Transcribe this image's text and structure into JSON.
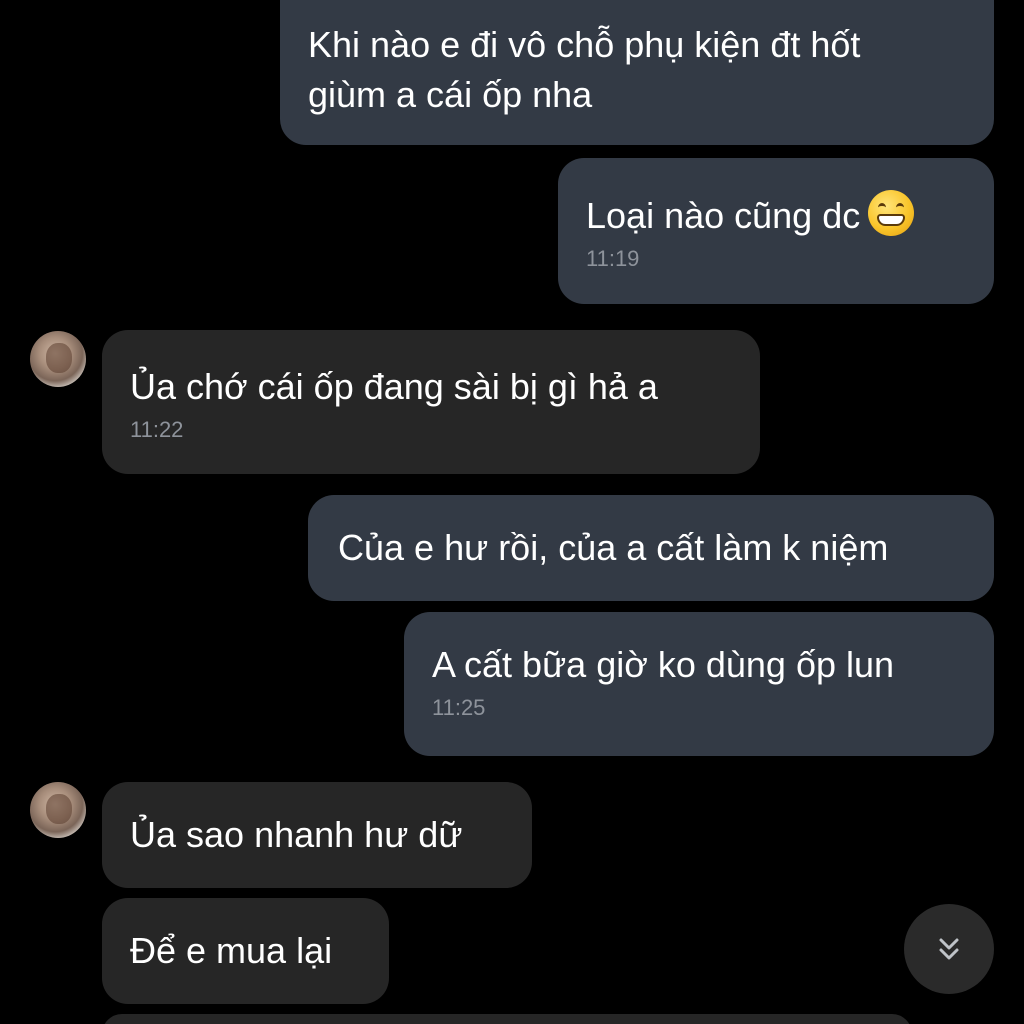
{
  "messages": [
    {
      "direction": "outgoing",
      "lines": [
        "Khi nào e đi vô chỗ phụ kiện đt hốt",
        "giùm a cái ốp nha"
      ]
    },
    {
      "direction": "outgoing",
      "text": "Loại nào cũng dc",
      "emoji": "grinning-face-emoji",
      "time": "11:19"
    },
    {
      "direction": "incoming",
      "text": "Ủa chớ cái ốp đang sài bị gì hả a",
      "time": "11:22"
    },
    {
      "direction": "outgoing",
      "text": "Của e hư rồi, của a cất làm k niệm"
    },
    {
      "direction": "outgoing",
      "text": "A cất bữa giờ ko dùng ốp lun",
      "time": "11:25"
    },
    {
      "direction": "incoming",
      "text": "Ủa sao nhanh hư dữ"
    },
    {
      "direction": "incoming",
      "text": "Để e mua lại"
    }
  ],
  "controls": {
    "scroll_down_icon": "double-chevron-down-icon"
  },
  "colors": {
    "background": "#000000",
    "outgoing_bubble": "#333a45",
    "incoming_bubble": "#262626",
    "text": "#ffffff",
    "timestamp": "#8e939b"
  }
}
